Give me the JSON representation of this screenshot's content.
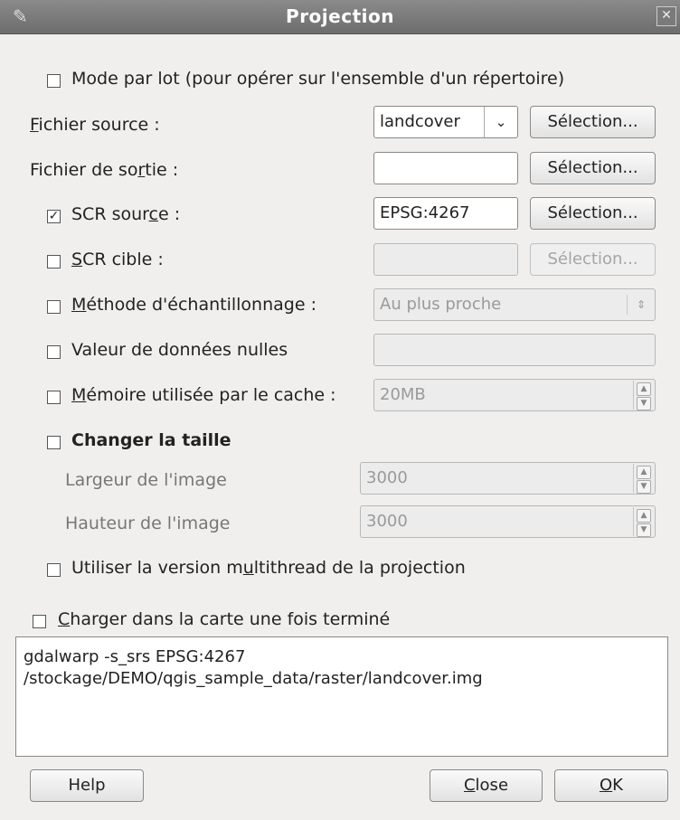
{
  "window": {
    "title": "Projection"
  },
  "batch_mode": {
    "label": "Mode par lot (pour opérer sur l'ensemble d'un répertoire)",
    "checked": false
  },
  "source_file": {
    "label_prefix": "",
    "label_underlined": "F",
    "label_suffix": "ichier source :",
    "value": "landcover",
    "button": "Sélection..."
  },
  "output_file": {
    "label_prefix": "Fichier de so",
    "label_underlined": "r",
    "label_suffix": "tie :",
    "value": "",
    "button": "Sélection..."
  },
  "source_crs": {
    "label_prefix": "SCR sour",
    "label_underlined": "c",
    "label_suffix": "e :",
    "checked": true,
    "value": "EPSG:4267",
    "button": "Sélection..."
  },
  "target_crs": {
    "label_prefix": "",
    "label_underlined": "S",
    "label_suffix": "CR cible :",
    "checked": false,
    "value": "",
    "button": "Sélection..."
  },
  "resampling": {
    "label_prefix": "",
    "label_underlined": "M",
    "label_suffix": "éthode d'échantillonnage :",
    "checked": false,
    "value": "Au plus proche"
  },
  "nodata": {
    "label": "Valeur de données nulles",
    "checked": false,
    "value": ""
  },
  "cache": {
    "label_prefix": "",
    "label_underlined": "M",
    "label_suffix": "émoire utilisée par le cache :",
    "checked": false,
    "value": "20MB"
  },
  "resize": {
    "label": "Changer la taille",
    "checked": false,
    "width_label": "Largeur de l'image",
    "width_value": "3000",
    "height_label": "Hauteur de l'image",
    "height_value": "3000"
  },
  "multithread": {
    "label_prefix": "Utiliser la version m",
    "label_underlined": "u",
    "label_suffix": "ltithread de la projection",
    "checked": false
  },
  "load_map": {
    "label_prefix": "",
    "label_underlined": "C",
    "label_suffix": "harger dans la carte une fois terminé",
    "checked": false
  },
  "command": {
    "line1": "gdalwarp -s_srs EPSG:4267",
    "line2": "/stockage/DEMO/qgis_sample_data/raster/landcover.img"
  },
  "buttons": {
    "help": "Help",
    "close_underlined": "C",
    "close_rest": "lose",
    "ok_underlined": "O",
    "ok_rest": "K"
  }
}
